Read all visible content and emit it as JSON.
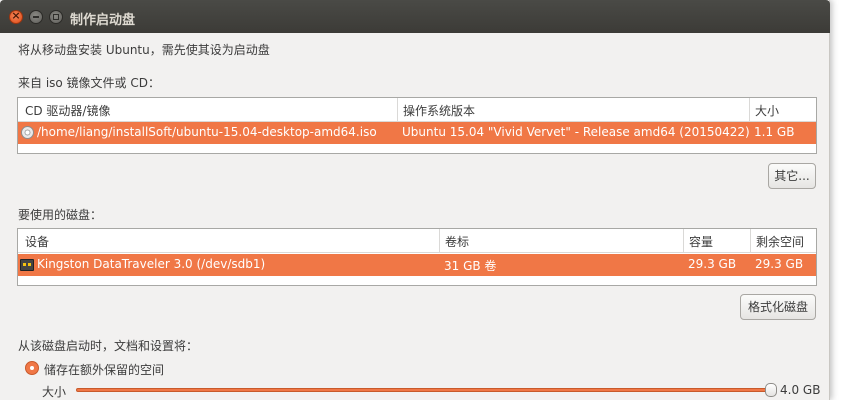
{
  "window": {
    "title": "制作启动盘"
  },
  "intro": "将从移动盘安装 Ubuntu，需先使其设为启动盘",
  "source_section": {
    "label": "来自 iso 镜像文件或 CD：",
    "columns": [
      "CD 驱动器/镜像",
      "操作系统版本",
      "大小"
    ],
    "rows": [
      {
        "icon": "cd-icon",
        "image": "/home/liang/installSoft/ubuntu-15.04-desktop-amd64.iso",
        "version": "Ubuntu 15.04 \"Vivid Vervet\" - Release amd64 (20150422)",
        "size": "1.1 GB"
      }
    ],
    "other_button": "其它..."
  },
  "disk_section": {
    "label": "要使用的磁盘：",
    "columns": [
      "设备",
      "卷标",
      "容量",
      "剩余空间"
    ],
    "rows": [
      {
        "icon": "usb-drive-icon",
        "device": "Kingston DataTraveler 3.0 (/dev/sdb1)",
        "label": "31 GB 卷",
        "capacity": "29.3 GB",
        "free": "29.3 GB"
      }
    ],
    "format_button": "格式化磁盘"
  },
  "persistence": {
    "label": "从该磁盘启动时，文档和设置将：",
    "option": "储存在额外保留的空间",
    "size_label": "大小",
    "size_value": "4.0 GB",
    "slider_fraction": 1.0
  },
  "colors": {
    "selection": "#f07746",
    "titlebar": "#3c3b37",
    "window_bg": "#f2f1f0"
  }
}
